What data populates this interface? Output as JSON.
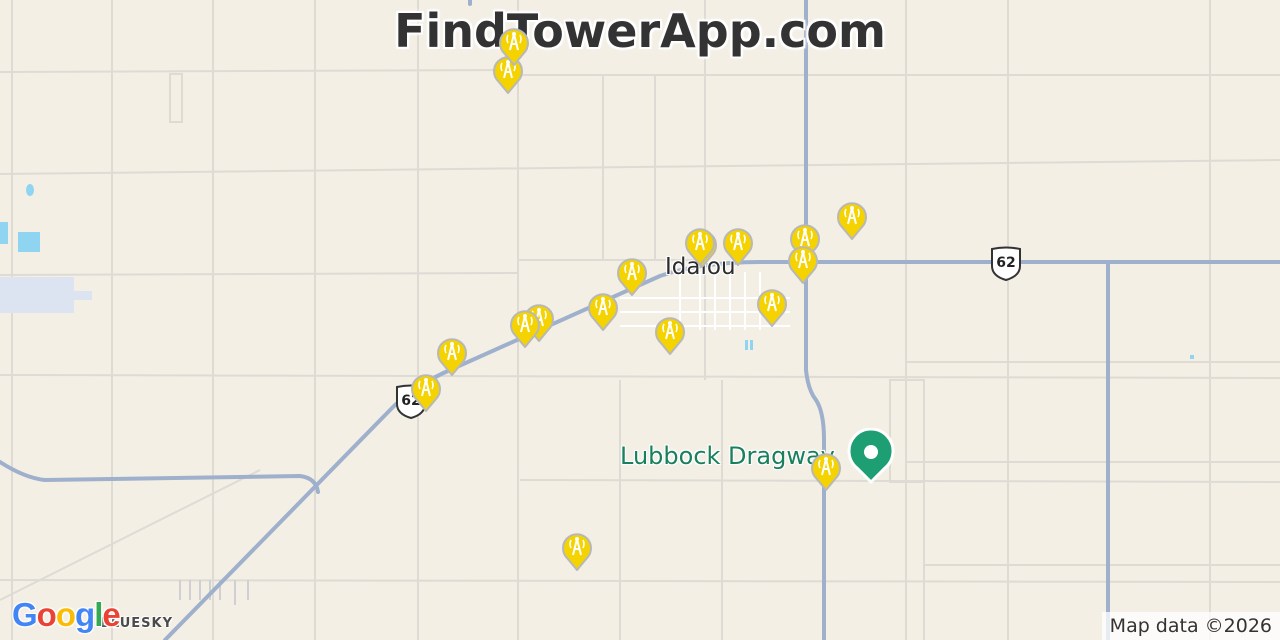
{
  "site": {
    "title": "FindTowerApp.com"
  },
  "map": {
    "town_label": "Idalou",
    "poi_label": "Lubbock Dragway",
    "area_label": "BLUESKY",
    "route_number": "62",
    "attribution": "Map data ©2026",
    "provider_logo": "Google",
    "tower_marker_icon": "cell-tower-icon",
    "tower_marker_color": "#f4d300",
    "poi_marker_icon": "location-pin-icon",
    "poi_marker_color": "#1e9e73",
    "land_color": "#f3efe5",
    "road_color": "#9fb0cc",
    "water_color": "#8fd4f0"
  }
}
